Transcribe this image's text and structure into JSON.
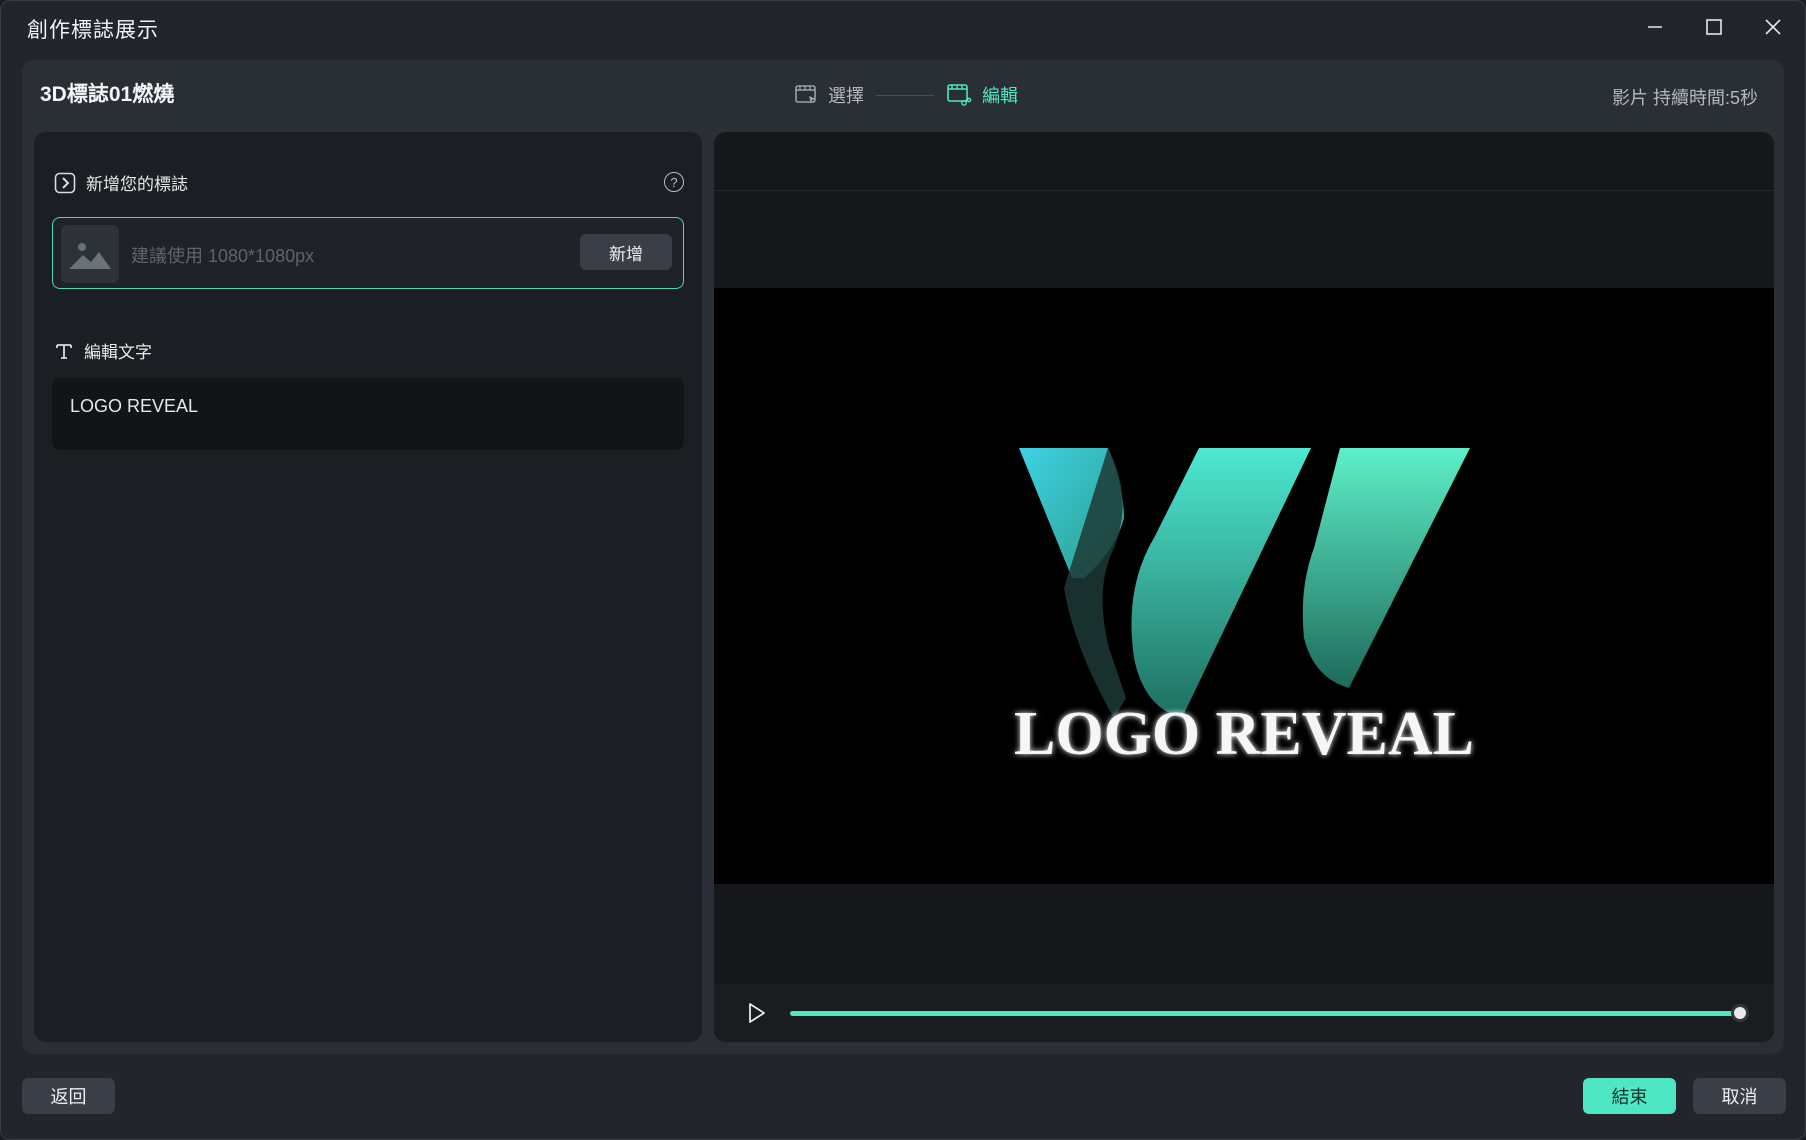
{
  "window": {
    "title": "創作標誌展示"
  },
  "header": {
    "project_name": "3D標誌01燃燒",
    "steps": [
      {
        "label": "選擇",
        "active": false,
        "icon": "film-select-icon"
      },
      {
        "label": "編輯",
        "active": true,
        "icon": "film-edit-icon"
      }
    ],
    "duration": "影片 持續時間:5秒"
  },
  "logo_section": {
    "heading": "新增您的標誌",
    "hint": "建議使用 1080*1080px",
    "add_button": "新增",
    "help": "?"
  },
  "text_section": {
    "heading": "編輯文字",
    "value": "LOGO REVEAL"
  },
  "preview": {
    "caption": "LOGO REVEAL",
    "progress_percent": 100
  },
  "footer": {
    "back": "返回",
    "finish": "結束",
    "cancel": "取消"
  },
  "colors": {
    "accent": "#4fe6c3",
    "panel": "#1b1e23",
    "background": "#22252b"
  }
}
